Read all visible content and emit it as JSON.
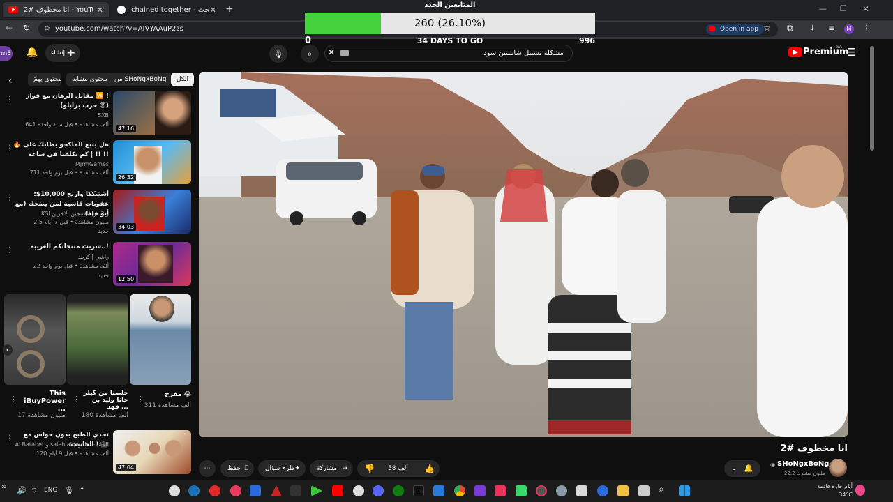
{
  "browser": {
    "tabs": [
      {
        "label": "انا مخطوف #2 - YouTube",
        "active": true
      },
      {
        "label": "chained together - بحث Google",
        "active": false
      }
    ],
    "new_tab": "+",
    "url": "youtube.com/watch?v=AIVYAAuP2zs",
    "open_in_app": "Open in app"
  },
  "overlay": {
    "title": "المتابعين الجدد",
    "progress_text": "260 (26.10%)",
    "progress_fraction": 0.261,
    "min": "0",
    "max": "996",
    "days_left": "34 DAYS TO GO",
    "fill_color": "#43d13c"
  },
  "youtube": {
    "logo": "Premium",
    "logo_region": "SA",
    "search_value": "مشكلة تشتيل شاشتين سود",
    "create_label": "إنشاء",
    "avatar_label": "m3"
  },
  "chips": [
    "الكل",
    "من SHoNgxBoNg",
    "محتوى مشابه",
    "محتوى يهمّ"
  ],
  "recommendations": [
    {
      "title": "مقابل الرهان مع فواز 🆚 ! (حرب برابلو 😡)",
      "channel": "SXB",
      "meta": "641 ألف مشاهدة • قبل سنة واحدة",
      "duration": "47:16"
    },
    {
      "title": "هل يبيع الماكجو بطابك على 🔥 !! | كم تكلفنا في ساعة !!",
      "channel": "MjrmGames",
      "meta": "711 ألف مشاهدة • قبل يوم واحد",
      "duration": "26:32"
    },
    {
      "title": "أشتيككا واربح 10,000$: عقوبات قاسية لمن يضحك (مع أبو فلة)",
      "channel": "KSI و 2 من المنتجين الآخرين",
      "meta": "2.5 مليون مشاهدة • قبل 7 أيام",
      "badge": "جديد",
      "duration": "34:03"
    },
    {
      "title": "شريت منتجاتكم الغريبة..!",
      "channel": "راشي | كريند",
      "meta": "22 ألف مشاهدة • قبل يوم واحد",
      "badge": "جديد",
      "duration": "12:50"
    }
  ],
  "shorts": [
    {
      "title": "This iBuyPower ...",
      "views": "17 مليون مشاهدة"
    },
    {
      "title": "خلصنا من كيلر جانا وليد بن فهد ...",
      "views": "180 ألف مشاهدة"
    },
    {
      "title": "مفرح 😂",
      "views": "311 ألف مشاهدة"
    }
  ],
  "bottom_rec": {
    "title": "تحدي الطبخ بدون حواس مع الجانيت ! 🎥",
    "channel": "ALBatabet و saleh alqarni | الجانيت",
    "meta": "120 ألف مشاهدة • قبل 9 أيام",
    "duration": "47:04"
  },
  "video": {
    "title": "انا مخطوف #2",
    "channel": "SHoNgxBoNg",
    "subscribers": "22.2 مليون مشترك",
    "likes": "58 ألف",
    "share": "مشاركة",
    "ask": "طرح سؤال",
    "save": "حفظ"
  },
  "taskbar": {
    "lang": "ENG",
    "weather_temp": "34°C",
    "weather_desc": "أيام حارة قادمة"
  }
}
